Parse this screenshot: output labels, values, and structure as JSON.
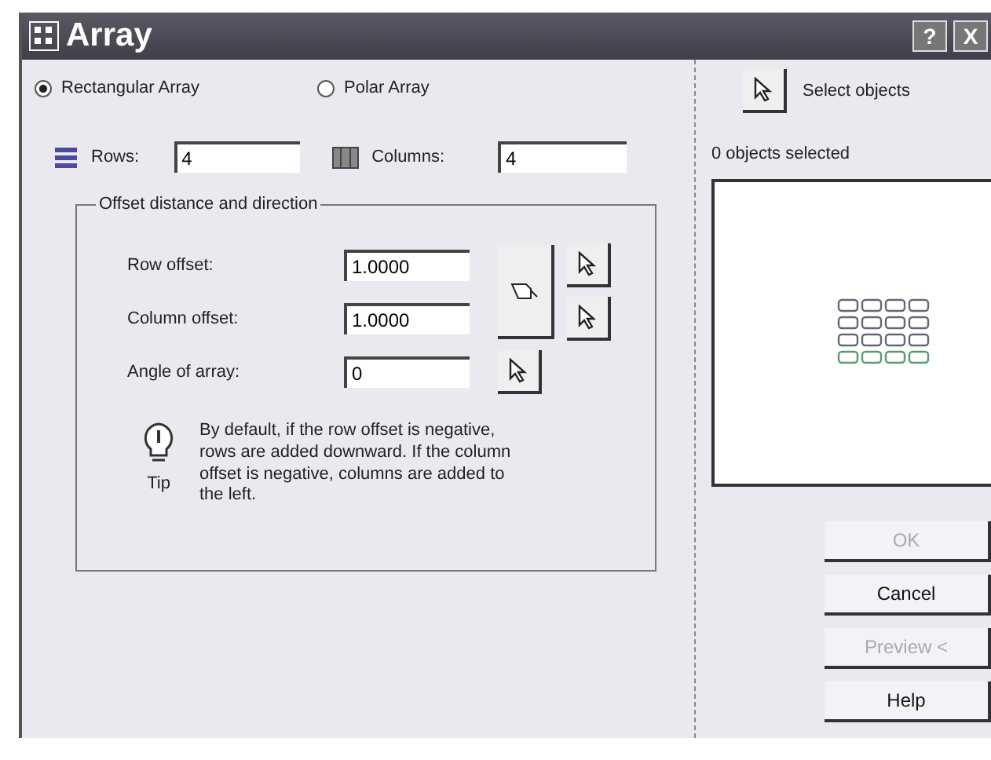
{
  "window": {
    "title": "Array",
    "controls": [
      "?",
      "X"
    ]
  },
  "array_types": [
    {
      "label": "Rectangular Array",
      "selected": true
    },
    {
      "label": "Polar Array",
      "selected": false
    }
  ],
  "rows": {
    "label": "Rows:",
    "value": "4"
  },
  "columns": {
    "label": "Columns:",
    "value": "4"
  },
  "offset_group": {
    "title": "Offset distance and direction",
    "fields": [
      {
        "label": "Row offset:",
        "value": "1.0000"
      },
      {
        "label": "Column offset:",
        "value": "1.0000"
      },
      {
        "label": "Angle of array:",
        "value": "0"
      }
    ],
    "tip": {
      "label": "Tip",
      "text": "By default, if the row offset is negative, rows are added downward. If the column offset is negative, columns are added to the left."
    }
  },
  "select_objects": {
    "label": "Select objects"
  },
  "selection_status": "0 objects selected",
  "buttons": [
    {
      "label": "OK",
      "disabled": true
    },
    {
      "label": "Cancel",
      "disabled": false
    },
    {
      "label": "Preview <",
      "disabled": true
    },
    {
      "label": "Help",
      "disabled": false
    }
  ]
}
